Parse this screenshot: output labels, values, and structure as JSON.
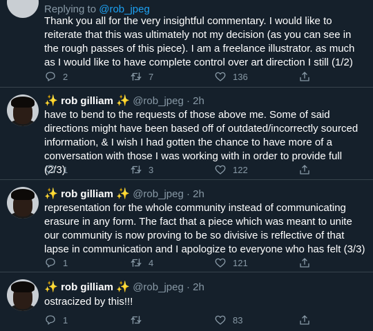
{
  "tweets": [
    {
      "replying_prefix": "Replying to ",
      "replying_handle": "@rob_jpeg",
      "text": "Thank you all for the very insightful commentary. I would like to reiterate that this was ultimately not my decision (as you can see in the rough passes of this piece). I am a freelance illustrator. as much as I would like to have complete control over art direction I still (1/2)",
      "replies": "2",
      "retweets": "7",
      "likes": "136"
    },
    {
      "name": "rob gilliam",
      "handle": "@rob_jpeg",
      "sep": "·",
      "time": "2h",
      "text": "have to bend to the requests of those above me. Some of said directions might have been based off of outdated/incorrectly sourced information, & I wish I had gotten the chance to have more of a conversation with those I was working with in order to provide full (2/3)",
      "replies": "1",
      "retweets": "3",
      "likes": "122"
    },
    {
      "name": "rob gilliam",
      "handle": "@rob_jpeg",
      "sep": "·",
      "time": "2h",
      "text": "representation for the whole community instead of communicating erasure in any form. The fact that a piece which was meant to unite our community is now proving to be so divisive is reflective of that lapse in communication and I apologize to everyone who has felt (3/3)",
      "replies": "1",
      "retweets": "4",
      "likes": "121"
    },
    {
      "name": "rob gilliam",
      "handle": "@rob_jpeg",
      "sep": "·",
      "time": "2h",
      "text": "ostracized by this!!!",
      "replies": "1",
      "retweets": "",
      "likes": "83"
    }
  ],
  "sparkle": "✨",
  "colors": {
    "background": "#15202b",
    "text": "#ffffff",
    "muted": "#8899a6",
    "accent": "#1da1f2",
    "divider": "#38444d"
  },
  "icons": [
    "reply-icon",
    "retweet-icon",
    "like-icon",
    "share-icon"
  ]
}
